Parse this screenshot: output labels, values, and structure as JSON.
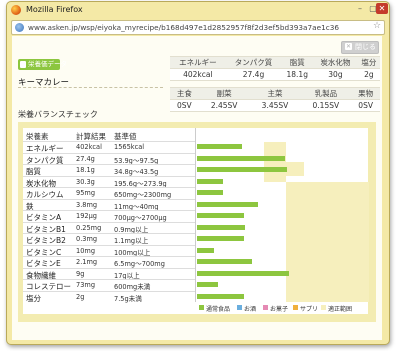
{
  "window": {
    "title": "Mozilla Firefox",
    "url": "www.asken.jp/wsp/eiyoka_myrecipe/b168d497e1d2852957f8f2d3ef5bd393a7ae1c36",
    "controls": {
      "minimize": "–",
      "maximize": "▢",
      "close": "✕"
    }
  },
  "page": {
    "close_button": "閉じる",
    "badge": "栄養価データ",
    "recipe_name": "キーマカレー",
    "section_title": "栄養バランスチェック",
    "summary": {
      "headers": [
        "エネルギー",
        "タンパク質",
        "脂質",
        "炭水化物",
        "塩分"
      ],
      "values": [
        "402kcal",
        "27.4g",
        "18.1g",
        "30g",
        "2g"
      ]
    },
    "meal_balance": {
      "headers": [
        "主食",
        "副菜",
        "主菜",
        "乳製品",
        "果物"
      ],
      "values": [
        "0SV",
        "2.45SV",
        "3.45SV",
        "0.15SV",
        "0SV"
      ]
    },
    "check_table": {
      "headers": [
        "栄養素",
        "計算結果",
        "基準値"
      ],
      "rows": [
        {
          "name": "エネルギー",
          "result": "402kcal",
          "standard": "1565kcal",
          "ratio": 0.26
        },
        {
          "name": "タンパク質",
          "result": "27.4g",
          "standard": "53.9g〜97.5g",
          "ratio": 0.51
        },
        {
          "name": "脂質",
          "result": "18.1g",
          "standard": "34.8g〜43.5g",
          "ratio": 0.52
        },
        {
          "name": "炭水化物",
          "result": "30.3g",
          "standard": "195.6g〜273.9g",
          "ratio": 0.15
        },
        {
          "name": "カルシウム",
          "result": "95mg",
          "standard": "650mg〜2300mg",
          "ratio": 0.15
        },
        {
          "name": "鉄",
          "result": "3.8mg",
          "standard": "11mg〜40mg",
          "ratio": 0.35
        },
        {
          "name": "ビタミンA",
          "result": "192μg",
          "standard": "700μg〜2700μg",
          "ratio": 0.27
        },
        {
          "name": "ビタミンB1",
          "result": "0.25mg",
          "standard": "0.9mg以上",
          "ratio": 0.28
        },
        {
          "name": "ビタミンB2",
          "result": "0.3mg",
          "standard": "1.1mg以上",
          "ratio": 0.27
        },
        {
          "name": "ビタミンC",
          "result": "10mg",
          "standard": "100mg以上",
          "ratio": 0.1
        },
        {
          "name": "ビタミンE",
          "result": "2.1mg",
          "standard": "6.5mg〜700mg",
          "ratio": 0.32
        },
        {
          "name": "食物繊維",
          "result": "9g",
          "standard": "17g以上",
          "ratio": 0.53
        },
        {
          "name": "コレステロー",
          "result": "73mg",
          "standard": "600mg未満",
          "ratio": 0.12
        },
        {
          "name": "塩分",
          "result": "2g",
          "standard": "7.5g未満",
          "ratio": 0.27
        }
      ]
    },
    "legend": [
      {
        "label": "通常食品",
        "color": "#8dc63f"
      },
      {
        "label": "お酒",
        "color": "#6aaede"
      },
      {
        "label": "お菓子",
        "color": "#e58ab4"
      },
      {
        "label": "サプリ",
        "color": "#f0b03c"
      },
      {
        "label": "適正範囲",
        "color": "#f6efbd"
      }
    ]
  }
}
